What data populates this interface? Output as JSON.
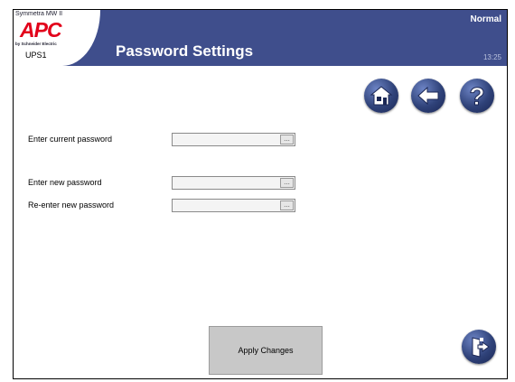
{
  "header": {
    "brand_model": "Symmetra MW II",
    "logo": "APC",
    "maker": "by Schneider Electric",
    "device_name": "UPS1",
    "title": "Password Settings",
    "status": "Normal",
    "time": "13:25"
  },
  "nav": {
    "home_icon": "home-icon",
    "back_icon": "back-arrow-icon",
    "help_icon": "question-mark-icon",
    "logout_icon": "exit-door-icon"
  },
  "form": {
    "current_password_label": "Enter current password",
    "current_password_value": "",
    "new_password_label": "Enter new password",
    "new_password_value": "",
    "reenter_password_label": "Re-enter new password",
    "reenter_password_value": "",
    "ellipsis": "..."
  },
  "actions": {
    "apply_label": "Apply Changes"
  },
  "colors": {
    "header_bg": "#3f4e8c",
    "logo_red": "#e2001a",
    "button_gray": "#c8c8c8"
  }
}
